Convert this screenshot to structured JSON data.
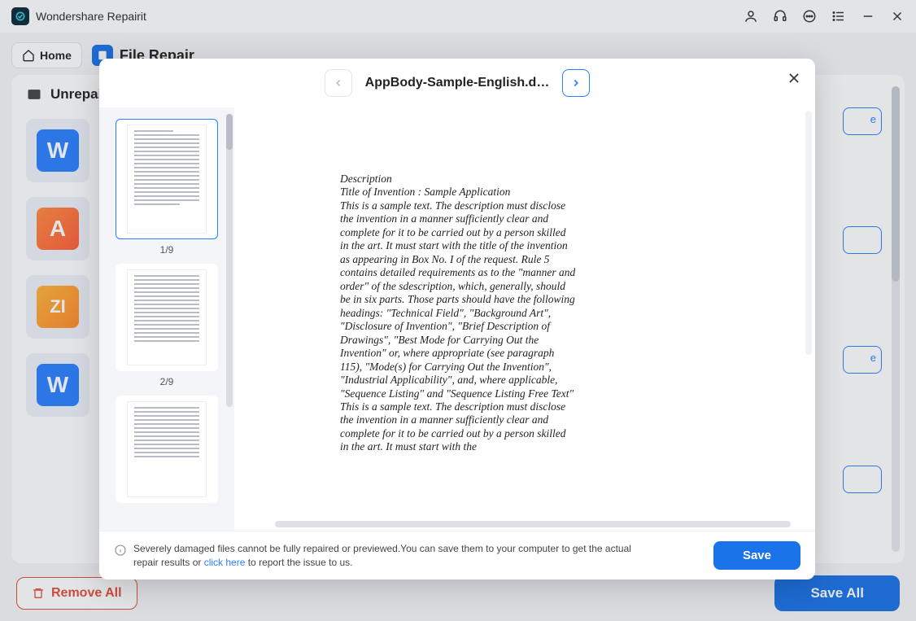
{
  "app": {
    "title": "Wondershare Repairit"
  },
  "header": {
    "home_label": "Home",
    "crumb_label": "File Repair"
  },
  "panel": {
    "title": "Unrepai"
  },
  "cards": {
    "items": [
      {
        "letter": "W",
        "tile": "tile-blue"
      },
      {
        "letter": "A",
        "tile": "tile-orange"
      },
      {
        "letter": "ZI",
        "tile": "tile-yellow"
      },
      {
        "letter": "W",
        "tile": "tile-blue"
      }
    ]
  },
  "side_labels": {
    "e1": "e",
    "e2": "e"
  },
  "footer": {
    "remove_all": "Remove All",
    "save_all": "Save All"
  },
  "modal": {
    "filename": "AppBody-Sample-English.d…",
    "thumbs": {
      "p1": "1/9",
      "p2": "2/9"
    },
    "preview_heading": "Description",
    "preview_title": "Title of Invention : Sample Application",
    "preview_body1": "This is a sample text. The description must disclose the invention in a manner sufficiently clear and complete for it to be carried out by a person skilled in the art. It must start with the title of the invention as appearing in Box No. I of the request. Rule 5 contains detailed requirements as to the \"manner and order\" of the sdescription, which, generally, should be in six parts. Those parts should have the following headings: \"Technical Field\", \"Background Art\", \"Disclosure of Invention\", \"Brief Description of Drawings\", \"Best Mode for Carrying Out the Invention\" or, where appropriate (see paragraph 115), \"Mode(s) for Carrying Out the Invention\", \"Industrial Applicability\", and, where applicable, \"Sequence Listing\" and \"Sequence Listing Free Text\"",
    "preview_body2": "This is a sample text. The description must disclose the invention in a manner sufficiently clear and complete for it to be carried out by a person skilled in the art. It must start with the",
    "footer_msg_a": "Severely damaged files cannot be fully repaired or previewed.You can save them to your computer to get the actual repair results or ",
    "footer_link": "click here",
    "footer_msg_b": " to report the issue to us.",
    "save_label": "Save"
  }
}
